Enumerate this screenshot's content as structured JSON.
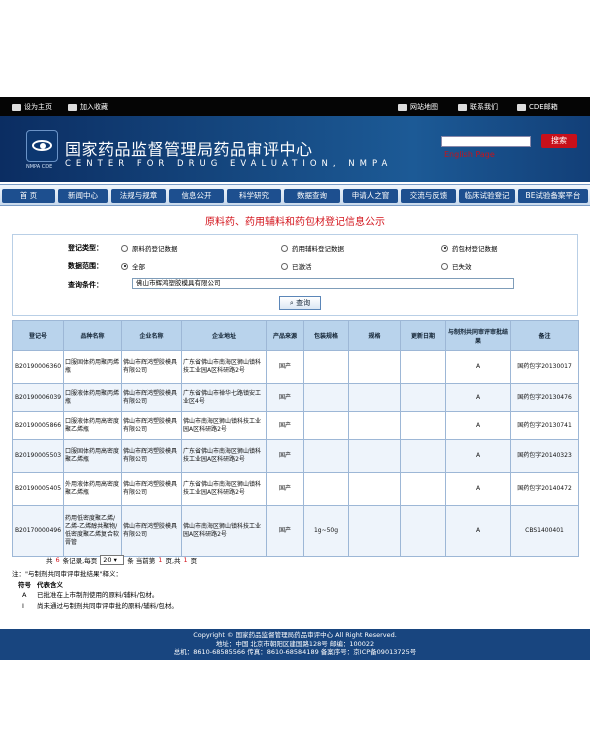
{
  "topbar": {
    "set_home": "设为主页",
    "add_fav": "加入收藏",
    "sitemap": "网站地图",
    "contact": "联系我们",
    "mail": "CDE邮箱"
  },
  "header": {
    "title_cn": "国家药品监督管理局药品审评中心",
    "title_en": "CENTER FOR DRUG EVALUATION, NMPA",
    "logo_sub": "NMPA CDE",
    "search_btn": "搜索",
    "english_link": "English Page"
  },
  "nav": [
    "首 页",
    "新闻中心",
    "法规与规章",
    "信息公开",
    "科学研究",
    "数据查询",
    "申请人之窗",
    "交流与反馈",
    "临床试验登记",
    "BE试验备案平台"
  ],
  "page_title": "原料药、药用辅料和药包材登记信息公示",
  "filters": {
    "type_label": "登记类型：",
    "type_options": [
      "原料药登记数据",
      "药用辅料登记数据",
      "药包材登记数据"
    ],
    "type_selected": 2,
    "scope_label": "数据范围：",
    "scope_options": [
      "全部",
      "已激活",
      "已失效"
    ],
    "scope_selected": 0,
    "query_label": "查询条件：",
    "query_value": "佛山市辉鸿塑胶模具有限公司",
    "query_btn": "查询"
  },
  "table": {
    "headers": [
      "登记号",
      "品种名称",
      "企业名称",
      "企业地址",
      "产品来源",
      "包装规格",
      "规格",
      "更新日期",
      "与制剂共同审评审批结果",
      "备注"
    ],
    "rows": [
      [
        "B20190006360",
        "口服固体药用聚丙烯瓶",
        "佛山市辉鸿塑胶模具有限公司",
        "广东省佛山市南海区狮山镇科技工业园A区科研路2号",
        "国产",
        "",
        "",
        "",
        "A",
        "国药包字20130017"
      ],
      [
        "B20190006039",
        "口服液体药用聚丙烯瓶",
        "佛山市辉鸿塑胶模具有限公司",
        "广东省佛山市禅华七路镇安工业区4号",
        "国产",
        "",
        "",
        "",
        "A",
        "国药包字20130476"
      ],
      [
        "B20190005866",
        "口服液体药用高密度聚乙烯瓶",
        "佛山市辉鸿塑胶模具有限公司",
        "佛山市南海区狮山镇科技工业园A区科研路2号",
        "国产",
        "",
        "",
        "",
        "A",
        "国药包字20130741"
      ],
      [
        "B20190005503",
        "口服固体药用高密度聚乙烯瓶",
        "佛山市辉鸿塑胶模具有限公司",
        "广东省佛山市南海区狮山镇科技工业园A区科研路2号",
        "国产",
        "",
        "",
        "",
        "A",
        "国药包字20140323"
      ],
      [
        "B20190005405",
        "外用液体药用高密度聚乙烯瓶",
        "佛山市辉鸿塑胶模具有限公司",
        "广东省佛山市南海区狮山镇科技工业园A区科研路2号",
        "国产",
        "",
        "",
        "",
        "A",
        "国药包字20140472"
      ],
      [
        "B20170000496",
        "药用低密度聚乙烯/乙烯-乙烯醇共聚物/低密度聚乙烯复合软膏管",
        "佛山市辉鸿塑胶模具有限公司",
        "佛山市南海区狮山镇科技工业园A区科研路2号",
        "国产",
        "1g~50g",
        "",
        "",
        "A",
        "CBS1400401"
      ]
    ]
  },
  "pager": {
    "pre": "共",
    "count": "6",
    "mid": "条记录,每页",
    "per_page": "20",
    "page_label": "条 当前第",
    "current": "1",
    "sep": "页,共",
    "total": "1",
    "post": "页"
  },
  "notes": {
    "title": "注：\"与制剂共同审评审批结果\"释义：",
    "head_symbol": "符号",
    "head_meaning": "代表含义",
    "items": [
      {
        "symbol": "A",
        "text": "已批准在上市制剂使用的原料/辅料/包材。"
      },
      {
        "symbol": "I",
        "text": "尚未通过与制剂共同审评审批的原料/辅料/包材。"
      }
    ]
  },
  "footer": {
    "line1": "Copyright © 国家药品监督管理局药品审评中心    All Right Reserved.",
    "line2": "地址：中国 北京市朝阳区建国路128号    邮编：100022",
    "line3": "总机：8610-68585566    传真：8610-68584189    备案序号：京ICP备09013725号"
  }
}
